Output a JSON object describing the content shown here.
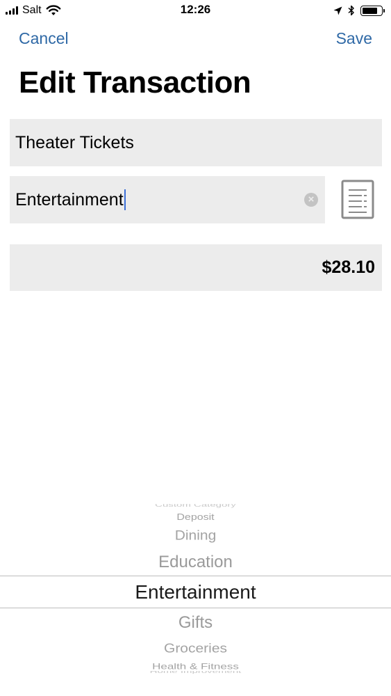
{
  "status_bar": {
    "carrier": "Salt",
    "time": "12:26",
    "signal_icon": "signal-bars-icon",
    "wifi_icon": "wifi-icon",
    "location_icon": "location-arrow-icon",
    "bluetooth_icon": "bluetooth-icon",
    "battery_icon": "battery-icon",
    "battery_level": 0.8
  },
  "nav": {
    "cancel_label": "Cancel",
    "save_label": "Save",
    "accent_color": "#2f69a6"
  },
  "page": {
    "title": "Edit Transaction"
  },
  "form": {
    "name_value": "Theater Tickets",
    "category_value": "Entertainment",
    "amount_value": "$28.10",
    "clear_icon": "clear-circle-icon",
    "category_list_icon": "receipt-list-icon"
  },
  "picker": {
    "items": [
      "Custom Category",
      "Deposit",
      "Dining",
      "Education",
      "Entertainment",
      "Gifts",
      "Groceries",
      "Health & Fitness",
      "Home Improvement"
    ],
    "selected": "Entertainment"
  }
}
